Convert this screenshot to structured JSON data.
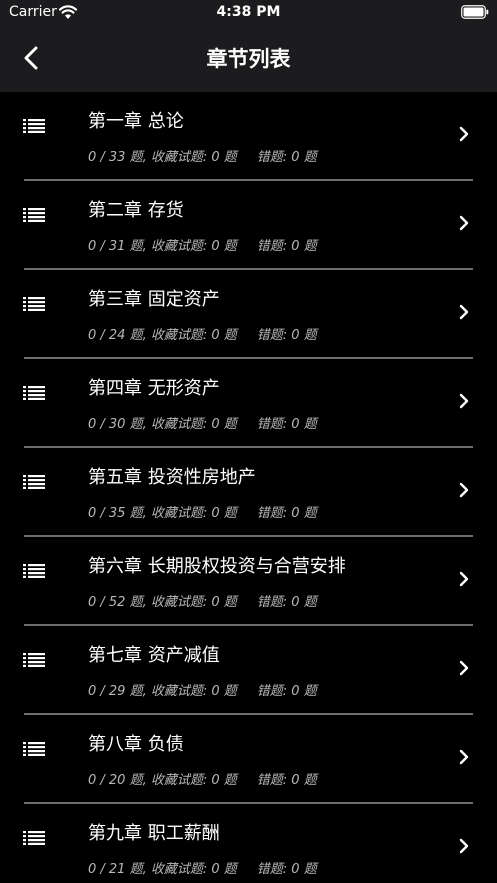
{
  "status_bar": {
    "carrier": "Carrier",
    "time": "4:38 PM",
    "wifi_icon": "wifi-icon",
    "battery_icon": "battery-icon"
  },
  "nav": {
    "title": "章节列表",
    "back_icon": "chevron-left-icon"
  },
  "chapters": [
    {
      "title": "第一章 总论",
      "progress": "0 / 33 题,",
      "favorites": "收藏试题: 0 题",
      "errors": "错题: 0 题"
    },
    {
      "title": "第二章 存货",
      "progress": "0 / 31 题,",
      "favorites": "收藏试题: 0 题",
      "errors": "错题: 0 题"
    },
    {
      "title": "第三章 固定资产",
      "progress": "0 / 24 题,",
      "favorites": "收藏试题: 0 题",
      "errors": "错题: 0 题"
    },
    {
      "title": "第四章 无形资产",
      "progress": "0 / 30 题,",
      "favorites": "收藏试题: 0 题",
      "errors": "错题: 0 题"
    },
    {
      "title": "第五章 投资性房地产",
      "progress": "0 / 35 题,",
      "favorites": "收藏试题: 0 题",
      "errors": "错题: 0 题"
    },
    {
      "title": "第六章 长期股权投资与合营安排",
      "progress": "0 / 52 题,",
      "favorites": "收藏试题: 0 题",
      "errors": "错题: 0 题"
    },
    {
      "title": "第七章 资产减值",
      "progress": "0 / 29 题,",
      "favorites": "收藏试题: 0 题",
      "errors": "错题: 0 题"
    },
    {
      "title": "第八章 负债",
      "progress": "0 / 20 题,",
      "favorites": "收藏试题: 0 题",
      "errors": "错题: 0 题"
    },
    {
      "title": "第九章 职工薪酬",
      "progress": "0 / 21 题,",
      "favorites": "收藏试题: 0 题",
      "errors": "错题: 0 题"
    }
  ],
  "icons": {
    "row_leading": "list-icon",
    "row_trailing": "chevron-right-icon"
  },
  "colors": {
    "background": "#000000",
    "bar": "#1c1c1e",
    "divider": "#6e6e6e",
    "secondary_text": "#b8b8b8"
  }
}
